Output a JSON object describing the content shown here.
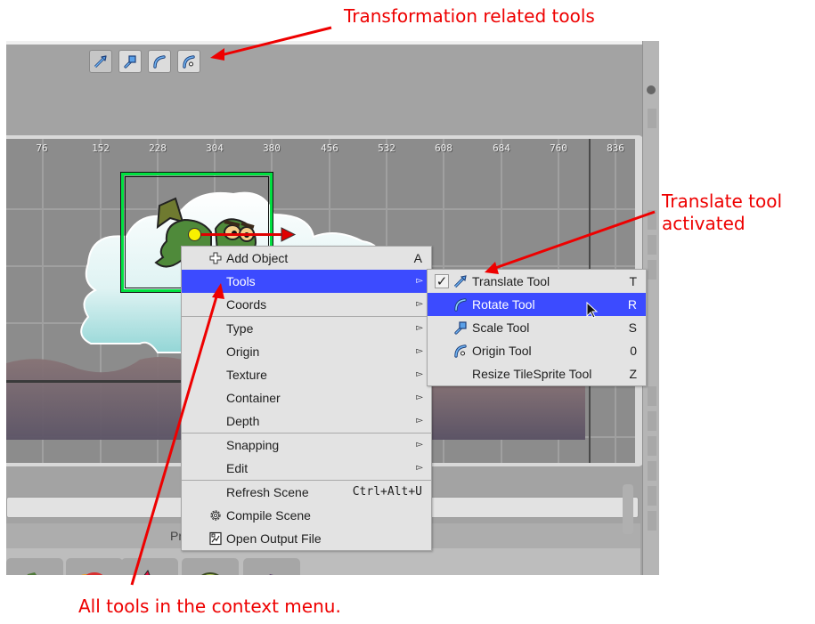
{
  "annotations": {
    "top": "Transformation related tools",
    "right_line1": "Translate tool",
    "right_line2": "activated",
    "bottom": "All tools in the context menu."
  },
  "toolbar": {
    "buttons": [
      {
        "name": "translate-tool",
        "icon": "translate-arrow-icon",
        "active": true
      },
      {
        "name": "scale-tool",
        "icon": "scale-icon",
        "active": false
      },
      {
        "name": "rotate-tool",
        "icon": "rotate-arc-icon",
        "active": false
      },
      {
        "name": "origin-tool",
        "icon": "origin-arc-icon",
        "active": false
      }
    ]
  },
  "scene": {
    "ruler_labels": [
      "76",
      "152",
      "228",
      "304",
      "380",
      "456",
      "532",
      "608",
      "684",
      "760",
      "836"
    ]
  },
  "bottom_panel": {
    "header_label": "Pr"
  },
  "context_menu": {
    "items": [
      {
        "label": "Add Object",
        "shortcut": "A",
        "icon": "plus-icon"
      },
      {
        "label": "Tools",
        "submenu": true,
        "selected": true
      },
      {
        "label": "Coords",
        "submenu": true
      },
      {
        "label": "Type",
        "submenu": true
      },
      {
        "label": "Origin",
        "submenu": true
      },
      {
        "label": "Texture",
        "submenu": true
      },
      {
        "label": "Container",
        "submenu": true
      },
      {
        "label": "Depth",
        "submenu": true
      },
      {
        "label": "Snapping",
        "submenu": true
      },
      {
        "label": "Edit",
        "submenu": true
      },
      {
        "label": "Refresh Scene",
        "shortcut": "Ctrl+Alt+U"
      },
      {
        "label": "Compile Scene",
        "icon": "gear-icon"
      },
      {
        "label": "Open Output File",
        "icon": "file-icon"
      }
    ],
    "submenu_arrow": "▻"
  },
  "tools_submenu": {
    "items": [
      {
        "label": "Translate Tool",
        "shortcut": "T",
        "checked": true,
        "icon": "translate-arrow-icon"
      },
      {
        "label": "Rotate Tool",
        "shortcut": "R",
        "selected": true,
        "icon": "rotate-arc-icon"
      },
      {
        "label": "Scale Tool",
        "shortcut": "S",
        "icon": "scale-icon"
      },
      {
        "label": "Origin Tool",
        "shortcut": "0",
        "icon": "origin-arc-icon"
      },
      {
        "label": "Resize TileSprite Tool",
        "shortcut": "Z"
      }
    ],
    "check_mark": "✓"
  },
  "colors": {
    "menu_highlight": "#3c4bff",
    "annotation_red": "#ee0000",
    "selection_green": "#00e040"
  }
}
